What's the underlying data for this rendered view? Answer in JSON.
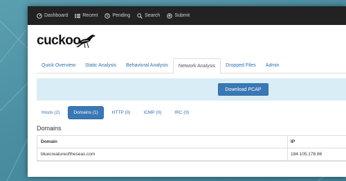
{
  "navbar": {
    "items": [
      {
        "label": "Dashboard",
        "icon": "dashboard-icon"
      },
      {
        "label": "Recent",
        "icon": "list-icon"
      },
      {
        "label": "Pending",
        "icon": "clock-icon"
      },
      {
        "label": "Search",
        "icon": "search-icon"
      },
      {
        "label": "Submit",
        "icon": "upload-icon"
      }
    ]
  },
  "logo": {
    "text": "cuckoo"
  },
  "tabs": [
    {
      "label": "Quick Overview",
      "active": false
    },
    {
      "label": "Static Analysis",
      "active": false
    },
    {
      "label": "Behavioral Analysis",
      "active": false
    },
    {
      "label": "Network Analysis",
      "active": true
    },
    {
      "label": "Dropped Files",
      "active": false
    },
    {
      "label": "Admin",
      "active": false
    }
  ],
  "banner": {
    "download_label": "Download PCAP"
  },
  "pills": [
    {
      "label": "Hosts (2)",
      "active": false
    },
    {
      "label": "Domains (1)",
      "active": true
    },
    {
      "label": "HTTP (0)",
      "active": false
    },
    {
      "label": "ICMP (0)",
      "active": false
    },
    {
      "label": "IRC (0)",
      "active": false
    }
  ],
  "domains": {
    "title": "Domains",
    "columns": [
      "Domain",
      "IP"
    ],
    "rows": [
      {
        "domain": "bluecreatureoftheseas.com",
        "ip": "184.105.178.86"
      }
    ]
  },
  "colors": {
    "accent": "#3a78b5",
    "navbar": "#222222",
    "banner": "#d9edf7",
    "link": "#2a6fae"
  }
}
